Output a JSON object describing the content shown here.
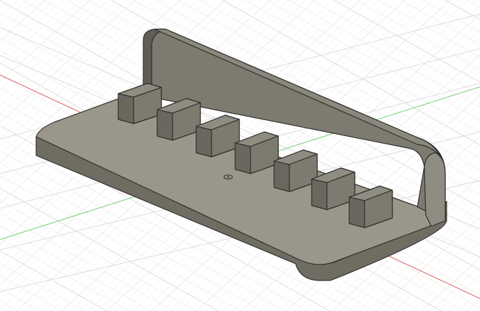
{
  "viewport": {
    "background": "#ffffff",
    "grid_color_major": "#d6d6d6",
    "grid_color_minor": "#ebebeb",
    "axis_x_color": "#e35b5b",
    "axis_y_color": "#6fcf6f"
  },
  "model": {
    "body_name": "phone-stand",
    "face_color_top": "#9a978a",
    "face_color_front": "#7d7a6f",
    "face_color_dark": "#5f5d55",
    "edge_color": "#2f2f2c",
    "slot_count": 7
  },
  "icons": {
    "origin": "origin-marker-icon"
  }
}
